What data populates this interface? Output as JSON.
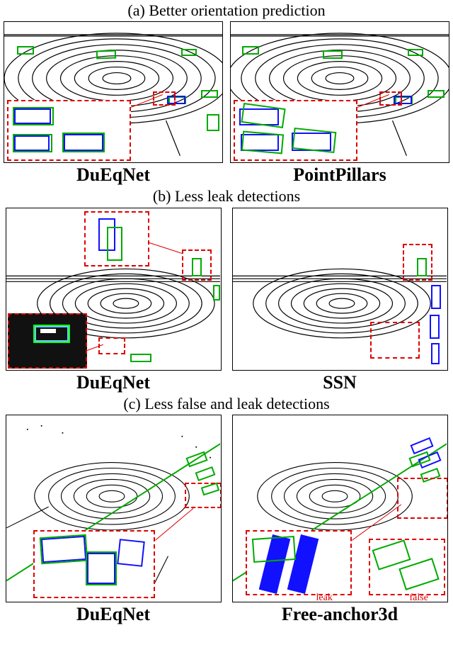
{
  "captions": {
    "a": "(a) Better orientation prediction",
    "b": "(b) Less leak detections",
    "c": "(c) Less false and leak detections"
  },
  "labels": {
    "a_left": "DuEqNet",
    "a_right": "PointPillars",
    "b_left": "DuEqNet",
    "b_right": "SSN",
    "c_left": "DuEqNet",
    "c_right": "Free-anchor3d"
  },
  "annotations": {
    "c_right_leak": "leak",
    "c_right_false": "false"
  },
  "colors": {
    "gt_box": "#00aa00",
    "pred_box": "#1111ff",
    "callout": "#dd0000"
  },
  "figure": {
    "description": "Qualitative comparison of 3D object detection results on LiDAR bird's-eye-view point cloud scenes. Green boxes = ground truth, blue boxes = predictions, red dashed boxes = highlighted regions of interest (leak/false detections or orientation differences).",
    "rows": [
      {
        "title": "(a) Better orientation prediction",
        "panels": [
          "DuEqNet",
          "PointPillars"
        ]
      },
      {
        "title": "(b) Less leak detections",
        "panels": [
          "DuEqNet",
          "SSN"
        ]
      },
      {
        "title": "(c) Less false and leak detections",
        "panels": [
          "DuEqNet",
          "Free-anchor3d"
        ]
      }
    ]
  }
}
